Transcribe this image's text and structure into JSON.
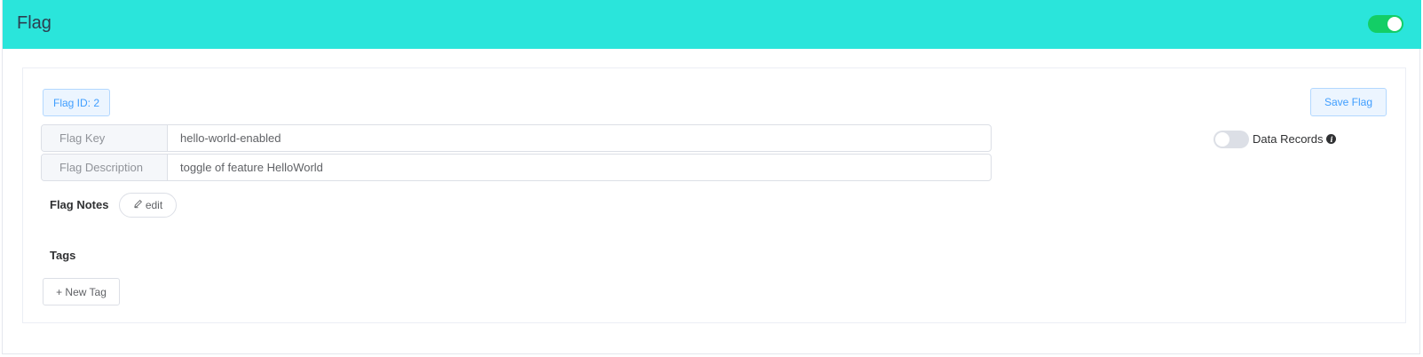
{
  "header": {
    "title": "Flag",
    "enabled": true,
    "accent_color": "#2ae5db",
    "switch_on_color": "#13ce66"
  },
  "flag": {
    "id_label": "Flag ID: 2",
    "save_label": "Save Flag",
    "key_label": "Flag Key",
    "key_value": "hello-world-enabled",
    "description_label": "Flag Description",
    "description_value": "toggle of feature HelloWorld",
    "data_records_label": "Data Records",
    "data_records_enabled": false,
    "notes_label": "Flag Notes",
    "edit_label": "edit",
    "tags_label": "Tags",
    "new_tag_label": "+ New Tag"
  },
  "icons": {
    "edit": "pencil-icon",
    "info": "info-icon"
  }
}
